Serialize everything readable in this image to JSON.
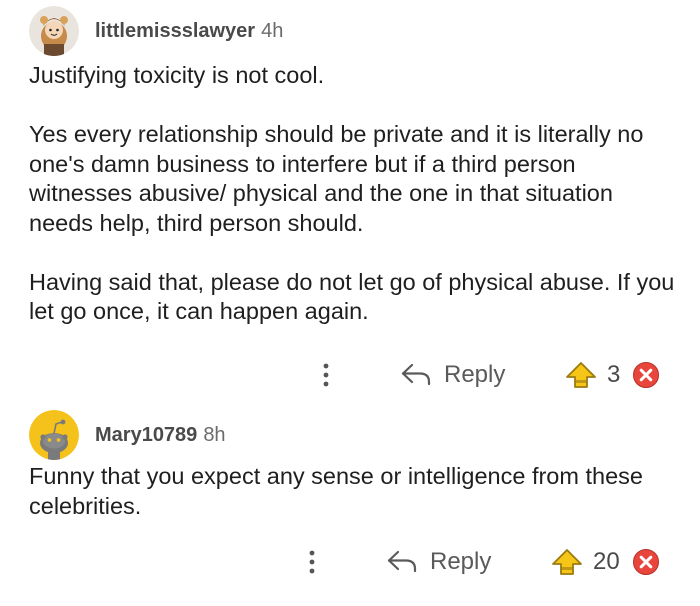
{
  "comments": [
    {
      "username": "littlemissslawyer",
      "time": "4h",
      "avatar_icon": "avatar-girl-icon",
      "paragraphs": [
        "Justifying toxicity is not cool.",
        "Yes every relationship should be private and it is literally no one's damn business to interfere but if a third person witnesses abusive/ physical and the one in that situation needs help, third person should.",
        "Having said that, please do not let go of physical abuse. If you let go once, it can happen again."
      ],
      "reply_label": "Reply",
      "score": "3"
    },
    {
      "username": "Mary10789",
      "time": "8h",
      "avatar_icon": "avatar-snoo-icon",
      "paragraphs": [
        "Funny that you expect any sense or intelligence from these celebrities."
      ],
      "reply_label": "Reply",
      "score": "20"
    }
  ],
  "colors": {
    "text": "#1f1f1f",
    "username": "#4a4a4a",
    "upvote": "#f5c518",
    "downvote": "#e8463d",
    "avatar_yellow": "#f4c21a"
  },
  "icons": {
    "more": "more-vertical-icon",
    "reply": "reply-arrow-icon",
    "upvote": "upvote-icon",
    "downvote": "downvote-icon"
  }
}
